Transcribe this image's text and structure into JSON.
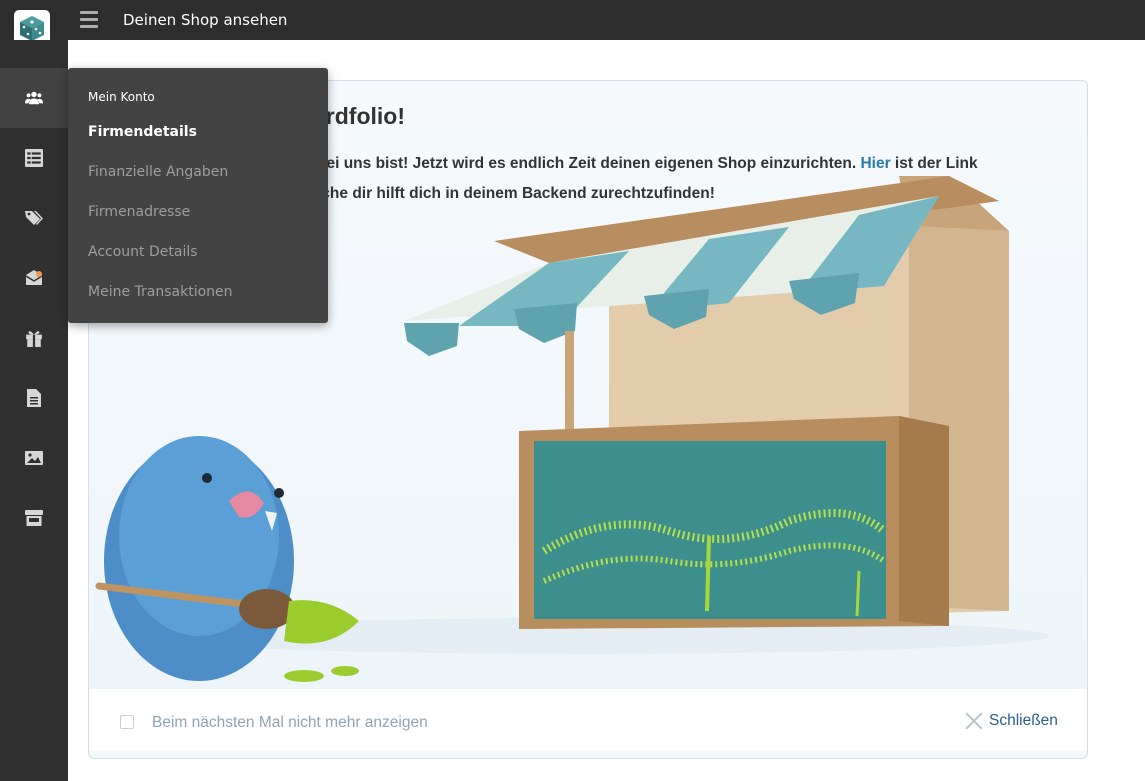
{
  "topbar": {
    "title": "Deinen Shop ansehen",
    "logo_icon": "dice-logo-icon",
    "menu_icon": "hamburger-icon"
  },
  "sidebar": {
    "items": [
      {
        "name": "users",
        "icon": "users-icon",
        "active": true
      },
      {
        "name": "list",
        "icon": "list-icon"
      },
      {
        "name": "tags",
        "icon": "tags-icon"
      },
      {
        "name": "mail",
        "icon": "envelope-icon",
        "notification": true
      },
      {
        "name": "gift",
        "icon": "gift-icon"
      },
      {
        "name": "document",
        "icon": "document-icon"
      },
      {
        "name": "image",
        "icon": "image-icon"
      },
      {
        "name": "store",
        "icon": "store-icon"
      }
    ],
    "notification_color": "#f2994a"
  },
  "dropdown": {
    "header": "Mein Konto",
    "items": [
      "Firmendetails",
      "Finanzielle Angaben",
      "Firmenadresse",
      "Account Details",
      "Meine Transaktionen"
    ],
    "active_index": 0
  },
  "welcome": {
    "title_visible": "ardfolio!",
    "line1_visible": "bei uns bist! Jetzt wird es endlich Zeit deinen eigenen Shop einzurichten.",
    "link_text": "Hier",
    "line1_end": "ist der Link",
    "line2_visible": "lche dir hilft dich in deinem Backend zurechtzufinden!",
    "dont_show_label": "Beim nächsten Mal nicht mehr anzeigen",
    "close_label": "Schließen"
  },
  "colors": {
    "accent": "#2a7ab0",
    "sidebar_bg": "#303030",
    "topbar_bg": "#2d2d2d",
    "dropdown_bg": "#434343"
  }
}
